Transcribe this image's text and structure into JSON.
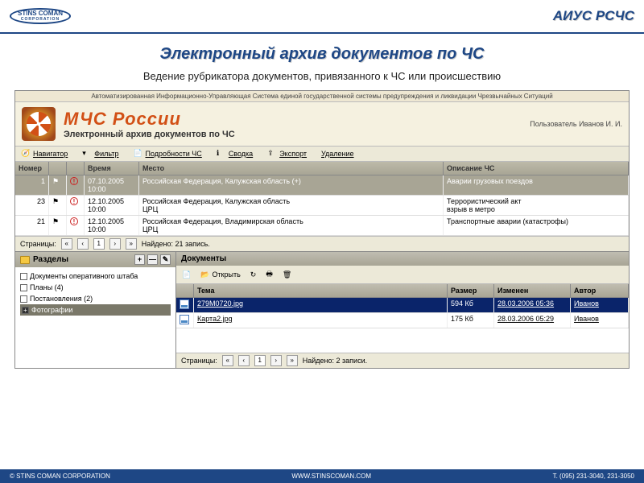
{
  "corp": {
    "name": "STINS COMAN",
    "sub": "CORPORATION"
  },
  "header_title": "АИУС РСЧС",
  "slide_title": "Электронный архив документов по ЧС",
  "subtitle": "Ведение рубрикатора документов, привязанного к ЧС или происшествию",
  "app": {
    "banner": "Автоматизированная Информационно-Управляющая Система единой государственной системы предупреждения и ликвидации Чрезвычайных Ситуаций",
    "org_title": "МЧС России",
    "page_title": "Электронный архив документов по ЧС",
    "user_label": "Пользователь",
    "user_name": "Иванов И. И."
  },
  "toolbar": {
    "nav": "Навигатор",
    "filter": "Фильтр",
    "details": "Подробности ЧС",
    "summary": "Сводка",
    "export": "Экспорт",
    "delete": "Удаление"
  },
  "grid": {
    "h_num": "Номер",
    "h_time": "Время",
    "h_place": "Место",
    "h_desc": "Описание ЧС",
    "rows": [
      {
        "num": "1",
        "time": "07.10.2005 10:00",
        "place": "Российская Федерация, Калужская область (+)",
        "desc": "Аварии грузовых поездов"
      },
      {
        "num": "23",
        "time": "12.10.2005 10:00",
        "place": "Российская Федерация, Калужская область\nЦРЦ",
        "desc": "Террористический акт\nвзрыв в метро"
      },
      {
        "num": "21",
        "time": "12.10.2005 10:00",
        "place": "Российская Федерация, Владимирская область\nЦРЦ",
        "desc": "Транспортные аварии (катастрофы)"
      }
    ]
  },
  "pager": {
    "label": "Страницы:",
    "current": "1",
    "found": "Найдено: 21 запись."
  },
  "sections": {
    "title": "Разделы",
    "items": [
      {
        "label": "Документы оперативного штаба"
      },
      {
        "label": "Планы (4)"
      },
      {
        "label": "Постановления (2)"
      },
      {
        "label": "Фотографии",
        "selected": true,
        "dark": true
      }
    ]
  },
  "docs": {
    "title": "Документы",
    "open_btn": "Открыть",
    "h_theme": "Тема",
    "h_size": "Размер",
    "h_mod": "Изменен",
    "h_auth": "Автор",
    "rows": [
      {
        "name": "279M0720.jpg",
        "size": "594 Кб",
        "mod": "28.03.2006 05:36",
        "auth": "Иванов",
        "selected": true
      },
      {
        "name": "Карта2.jpg",
        "size": "175 Кб",
        "mod": "28.03.2006 05:29",
        "auth": "Иванов"
      }
    ]
  },
  "docs_pager": {
    "label": "Страницы:",
    "current": "1",
    "found": "Найдено: 2 записи."
  },
  "footer": {
    "left": "© STINS COMAN CORPORATION",
    "center": "WWW.STINSCOMAN.COM",
    "right": "Т. (095) 231-3040, 231-3050"
  }
}
